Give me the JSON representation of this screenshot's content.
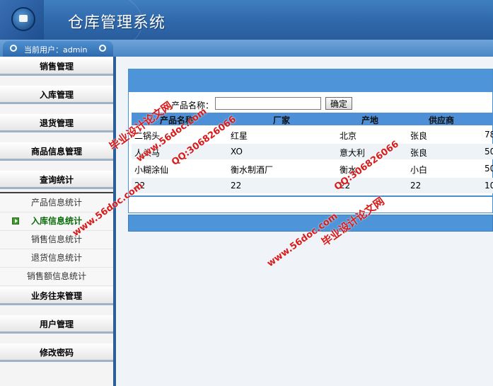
{
  "header": {
    "title": "仓库管理系统"
  },
  "user_bar": {
    "label": "当前用户：admin"
  },
  "sidebar": {
    "menu": [
      {
        "label": "销售管理"
      },
      {
        "label": "入库管理"
      },
      {
        "label": "退货管理"
      },
      {
        "label": "商品信息管理"
      },
      {
        "label": "查询统计"
      },
      {
        "label": "业务往来管理"
      },
      {
        "label": "用户管理"
      },
      {
        "label": "修改密码"
      }
    ],
    "submenu": [
      {
        "label": "产品信息统计"
      },
      {
        "label": "入库信息统计"
      },
      {
        "label": "销售信息统计"
      },
      {
        "label": "退货信息统计"
      },
      {
        "label": "销售额信息统计"
      }
    ]
  },
  "search": {
    "label": "产品名称：",
    "value": "",
    "button": "确定"
  },
  "table": {
    "headers": [
      "产品名称",
      "厂家",
      "产地",
      "供应商"
    ],
    "rows": [
      [
        "二锅头",
        "红星",
        "北京",
        "张良",
        "78"
      ],
      [
        "人头马",
        "XO",
        "意大利",
        "张良",
        "50"
      ],
      [
        "小糊涂仙",
        "衡水制酒厂",
        "衡水",
        "小白",
        "50"
      ],
      [
        "22",
        "22",
        "22",
        "22",
        "10"
      ]
    ]
  },
  "watermark": {
    "site": "www.56doc.com",
    "qq": "QQ:306826066",
    "name": "毕业设计论文网"
  }
}
